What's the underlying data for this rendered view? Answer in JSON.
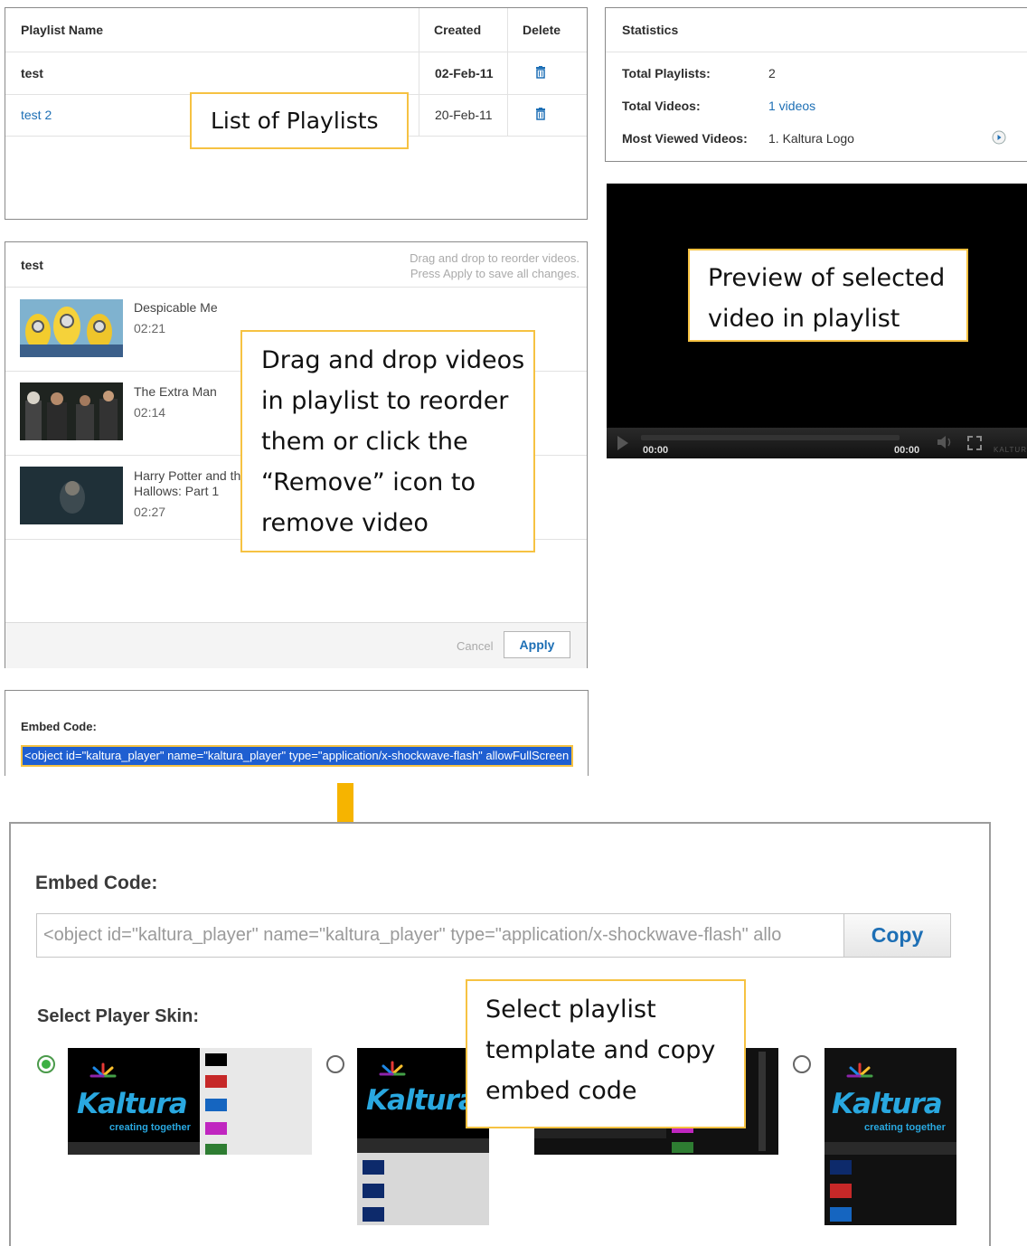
{
  "playlists_table": {
    "headers": {
      "name": "Playlist Name",
      "created": "Created",
      "delete": "Delete"
    },
    "rows": [
      {
        "name": "test",
        "created": "02-Feb-11"
      },
      {
        "name": "test 2",
        "created": "20-Feb-11"
      }
    ]
  },
  "statistics": {
    "title": "Statistics",
    "total_playlists_label": "Total Playlists:",
    "total_playlists_value": "2",
    "total_videos_label": "Total Videos:",
    "total_videos_value": "1 videos",
    "most_viewed_label": "Most Viewed Videos:",
    "most_viewed_value": "1. Kaltura Logo"
  },
  "playlist_editor": {
    "title": "test",
    "hint_line1": "Drag and drop to reorder videos.",
    "hint_line2": "Press Apply to save all changes.",
    "videos": [
      {
        "title": "Despicable Me",
        "duration": "02:21"
      },
      {
        "title": "The Extra Man",
        "duration": "02:14"
      },
      {
        "title_line1": "Harry Potter and th",
        "title_line2": "Hallows: Part 1",
        "duration": "02:27"
      }
    ],
    "cancel_label": "Cancel",
    "apply_label": "Apply"
  },
  "player": {
    "time_current": "00:00",
    "time_total": "00:00",
    "brand": "KALTURA"
  },
  "embed_small": {
    "label": "Embed Code:",
    "code": "<object id=\"kaltura_player\" name=\"kaltura_player\" type=\"application/x-shockwave-flash\" allowFullScreen"
  },
  "embed_large": {
    "label": "Embed Code:",
    "code": "<object id=\"kaltura_player\" name=\"kaltura_player\" type=\"application/x-shockwave-flash\" allo",
    "copy_label": "Copy",
    "skin_label": "Select Player Skin:",
    "skins": [
      {
        "selected": true
      },
      {
        "selected": false
      },
      {
        "selected": false
      },
      {
        "selected": false
      }
    ],
    "kaltura_text": "Kaltura",
    "kaltura_tagline": "creating together"
  },
  "callouts": {
    "list_of_playlists": "List of Playlists",
    "preview_line1": "Preview of selected",
    "preview_line2": "video in playlist",
    "drag_line1": "Drag and drop videos",
    "drag_line2": "in playlist to reorder",
    "drag_line3": "them or click the",
    "drag_line4": "“Remove” icon to",
    "drag_line5": "remove video",
    "select_line1": "Select playlist",
    "select_line2": "template and copy",
    "select_line3": "embed code"
  },
  "colors": {
    "callout_border": "#f6c242",
    "arrow": "#f6b400",
    "link": "#1d6fb5",
    "embed_highlight": "#1f5fd1",
    "radio_selected": "#3cb043"
  }
}
